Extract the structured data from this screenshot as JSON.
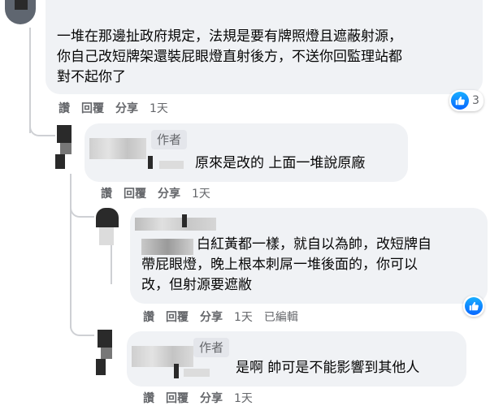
{
  "comment1": {
    "text_line1": "一堆在那邊扯政府規定，法規是要有牌照燈且遮蔽射源，",
    "text_line2": "你自己改短牌架還裝屁眼燈直射後方，不送你回監理站都",
    "text_line3": "對不起你了",
    "reactions": {
      "count": "3",
      "icon": "like-icon"
    },
    "actions": {
      "like": "讚",
      "reply": "回覆",
      "share": "分享",
      "time": "1天"
    }
  },
  "reply1": {
    "badge": "作者",
    "text": "原來是改的 上面一堆說原廠",
    "actions": {
      "like": "讚",
      "reply": "回覆",
      "share": "分享",
      "time": "1天"
    }
  },
  "reply2": {
    "text_line1": "白紅黃都一樣，就自以為帥，改短牌自",
    "text_line2": "帶屁眼燈，晚上根本刺屌一堆後面的，你可以",
    "text_line3": "改，但射源要遮敝",
    "reactions": {
      "icon": "like-icon"
    },
    "actions": {
      "like": "讚",
      "reply": "回覆",
      "share": "分享",
      "time": "1天",
      "edited": "已編輯"
    }
  },
  "reply3": {
    "badge": "作者",
    "text": "是啊 帥可是不能影響到其他人",
    "actions": {
      "like": "讚",
      "reply": "回覆",
      "share": "分享",
      "time": "1天"
    }
  },
  "colors": {
    "bubble": "#f0f2f5",
    "meta_text": "#65676b",
    "like_blue": "#0866ff",
    "thread_line": "#ced0d4"
  }
}
